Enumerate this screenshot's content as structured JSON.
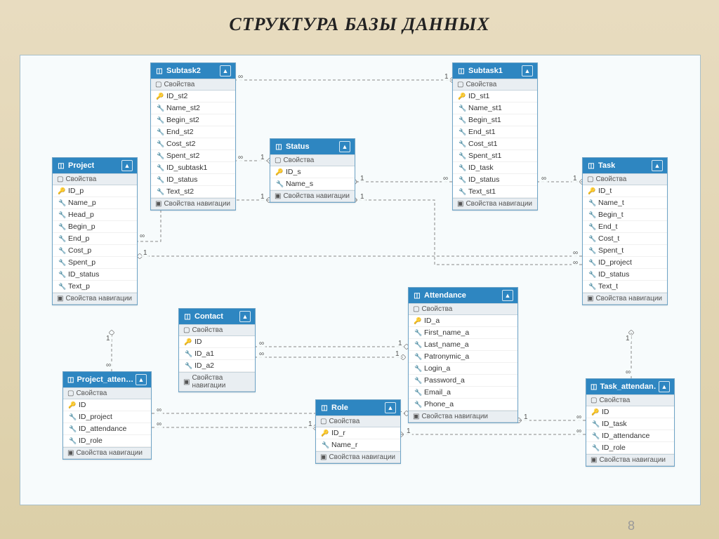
{
  "page": {
    "title": "СТРУКТУРА БАЗЫ ДАННЫХ",
    "number": "8"
  },
  "labels": {
    "properties": "Свойства",
    "nav_properties": "Свойства навигации"
  },
  "symbols": {
    "one": "1",
    "many": "∞"
  },
  "entities": {
    "project": {
      "name": "Project",
      "fields": [
        "ID_p",
        "Name_p",
        "Head_p",
        "Begin_p",
        "End_p",
        "Cost_p",
        "Spent_p",
        "ID_status",
        "Text_p"
      ],
      "pk": [
        "ID_p"
      ]
    },
    "subtask2": {
      "name": "Subtask2",
      "fields": [
        "ID_st2",
        "Name_st2",
        "Begin_st2",
        "End_st2",
        "Cost_st2",
        "Spent_st2",
        "ID_subtask1",
        "ID_status",
        "Text_st2"
      ],
      "pk": [
        "ID_st2"
      ]
    },
    "status": {
      "name": "Status",
      "fields": [
        "ID_s",
        "Name_s"
      ],
      "pk": [
        "ID_s"
      ]
    },
    "subtask1": {
      "name": "Subtask1",
      "fields": [
        "ID_st1",
        "Name_st1",
        "Begin_st1",
        "End_st1",
        "Cost_st1",
        "Spent_st1",
        "ID_task",
        "ID_status",
        "Text_st1"
      ],
      "pk": [
        "ID_st1"
      ]
    },
    "task": {
      "name": "Task",
      "fields": [
        "ID_t",
        "Name_t",
        "Begin_t",
        "End_t",
        "Cost_t",
        "Spent_t",
        "ID_project",
        "ID_status",
        "Text_t"
      ],
      "pk": [
        "ID_t"
      ]
    },
    "contact": {
      "name": "Contact",
      "fields": [
        "ID",
        "ID_a1",
        "ID_a2"
      ],
      "pk": [
        "ID"
      ]
    },
    "attendance": {
      "name": "Attendance",
      "fields": [
        "ID_a",
        "First_name_a",
        "Last_name_a",
        "Patronymic_a",
        "Login_a",
        "Password_a",
        "Email_a",
        "Phone_a"
      ],
      "pk": [
        "ID_a"
      ]
    },
    "project_atten": {
      "name": "Project_atten…",
      "fields": [
        "ID",
        "ID_project",
        "ID_attendance",
        "ID_role"
      ],
      "pk": [
        "ID"
      ]
    },
    "role": {
      "name": "Role",
      "fields": [
        "ID_r",
        "Name_r"
      ],
      "pk": [
        "ID_r"
      ]
    },
    "task_attendan": {
      "name": "Task_attendan…",
      "fields": [
        "ID",
        "ID_task",
        "ID_attendance",
        "ID_role"
      ],
      "pk": [
        "ID"
      ]
    }
  },
  "relationships": [
    {
      "from": "Subtask2",
      "to": "Status",
      "from_card": "∞",
      "to_card": "1"
    },
    {
      "from": "Subtask2",
      "to": "Subtask1",
      "from_card": "∞",
      "to_card": "1"
    },
    {
      "from": "Subtask1",
      "to": "Status",
      "from_card": "∞",
      "to_card": "1"
    },
    {
      "from": "Subtask1",
      "to": "Task",
      "from_card": "∞",
      "to_card": "1"
    },
    {
      "from": "Project",
      "to": "Status",
      "from_card": "∞",
      "to_card": "1"
    },
    {
      "from": "Task",
      "to": "Status",
      "from_card": "∞",
      "to_card": "1"
    },
    {
      "from": "Task",
      "to": "Project",
      "from_card": "∞",
      "to_card": "1"
    },
    {
      "from": "Project_atten",
      "to": "Project",
      "from_card": "∞",
      "to_card": "1"
    },
    {
      "from": "Project_atten",
      "to": "Attendance",
      "from_card": "∞",
      "to_card": "1"
    },
    {
      "from": "Project_atten",
      "to": "Role",
      "from_card": "∞",
      "to_card": "1"
    },
    {
      "from": "Task_attendan",
      "to": "Task",
      "from_card": "∞",
      "to_card": "1"
    },
    {
      "from": "Task_attendan",
      "to": "Attendance",
      "from_card": "∞",
      "to_card": "1"
    },
    {
      "from": "Task_attendan",
      "to": "Role",
      "from_card": "∞",
      "to_card": "1"
    },
    {
      "from": "Contact",
      "to": "Attendance",
      "from_card": "∞",
      "to_card": "1"
    },
    {
      "from": "Contact",
      "to": "Attendance",
      "from_card": "∞",
      "to_card": "1"
    }
  ]
}
